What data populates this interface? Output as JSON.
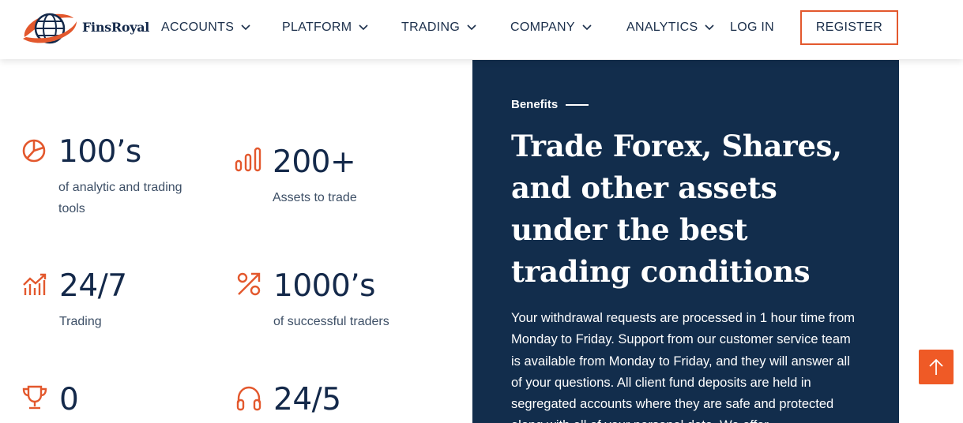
{
  "brand": {
    "name": "FinsRoyal",
    "accent_color": "#e3582d",
    "navy_color": "#122d4c"
  },
  "nav": {
    "items": [
      {
        "label": "ACCOUNTS",
        "has_dropdown": true
      },
      {
        "label": "PLATFORM",
        "has_dropdown": true
      },
      {
        "label": "TRADING",
        "has_dropdown": true
      },
      {
        "label": "COMPANY",
        "has_dropdown": true
      },
      {
        "label": "ANALYTICS",
        "has_dropdown": true
      }
    ],
    "login_label": "LOG IN",
    "register_label": "REGISTER"
  },
  "stats": [
    {
      "value": "100’s",
      "label": "of analytic and trading tools",
      "icon": "pie-chart-icon"
    },
    {
      "value": "200+",
      "label": "Assets to trade",
      "icon": "bar-chart-icon"
    },
    {
      "value": "24/7",
      "label": "Trading",
      "icon": "growth-chart-icon"
    },
    {
      "value": "1000’s",
      "label": "of successful traders",
      "icon": "percent-arrow-icon"
    },
    {
      "value": "0",
      "label": "",
      "icon": "trophy-icon"
    },
    {
      "value": "24/5",
      "label": "",
      "icon": "headphones-icon"
    }
  ],
  "benefits": {
    "tag": "Benefits",
    "title": "Trade Forex, Shares, and other assets under the best trading conditions",
    "body": "Your withdrawal requests are processed in 1 hour time from Monday to Friday. Support from our customer service team is available from Monday to Friday, and they will answer all of your questions. All client fund deposits are held in segregated accounts where they are safe and protected along with all of your personal data. We offer"
  },
  "scroll_top": {
    "icon": "arrow-up-icon"
  }
}
